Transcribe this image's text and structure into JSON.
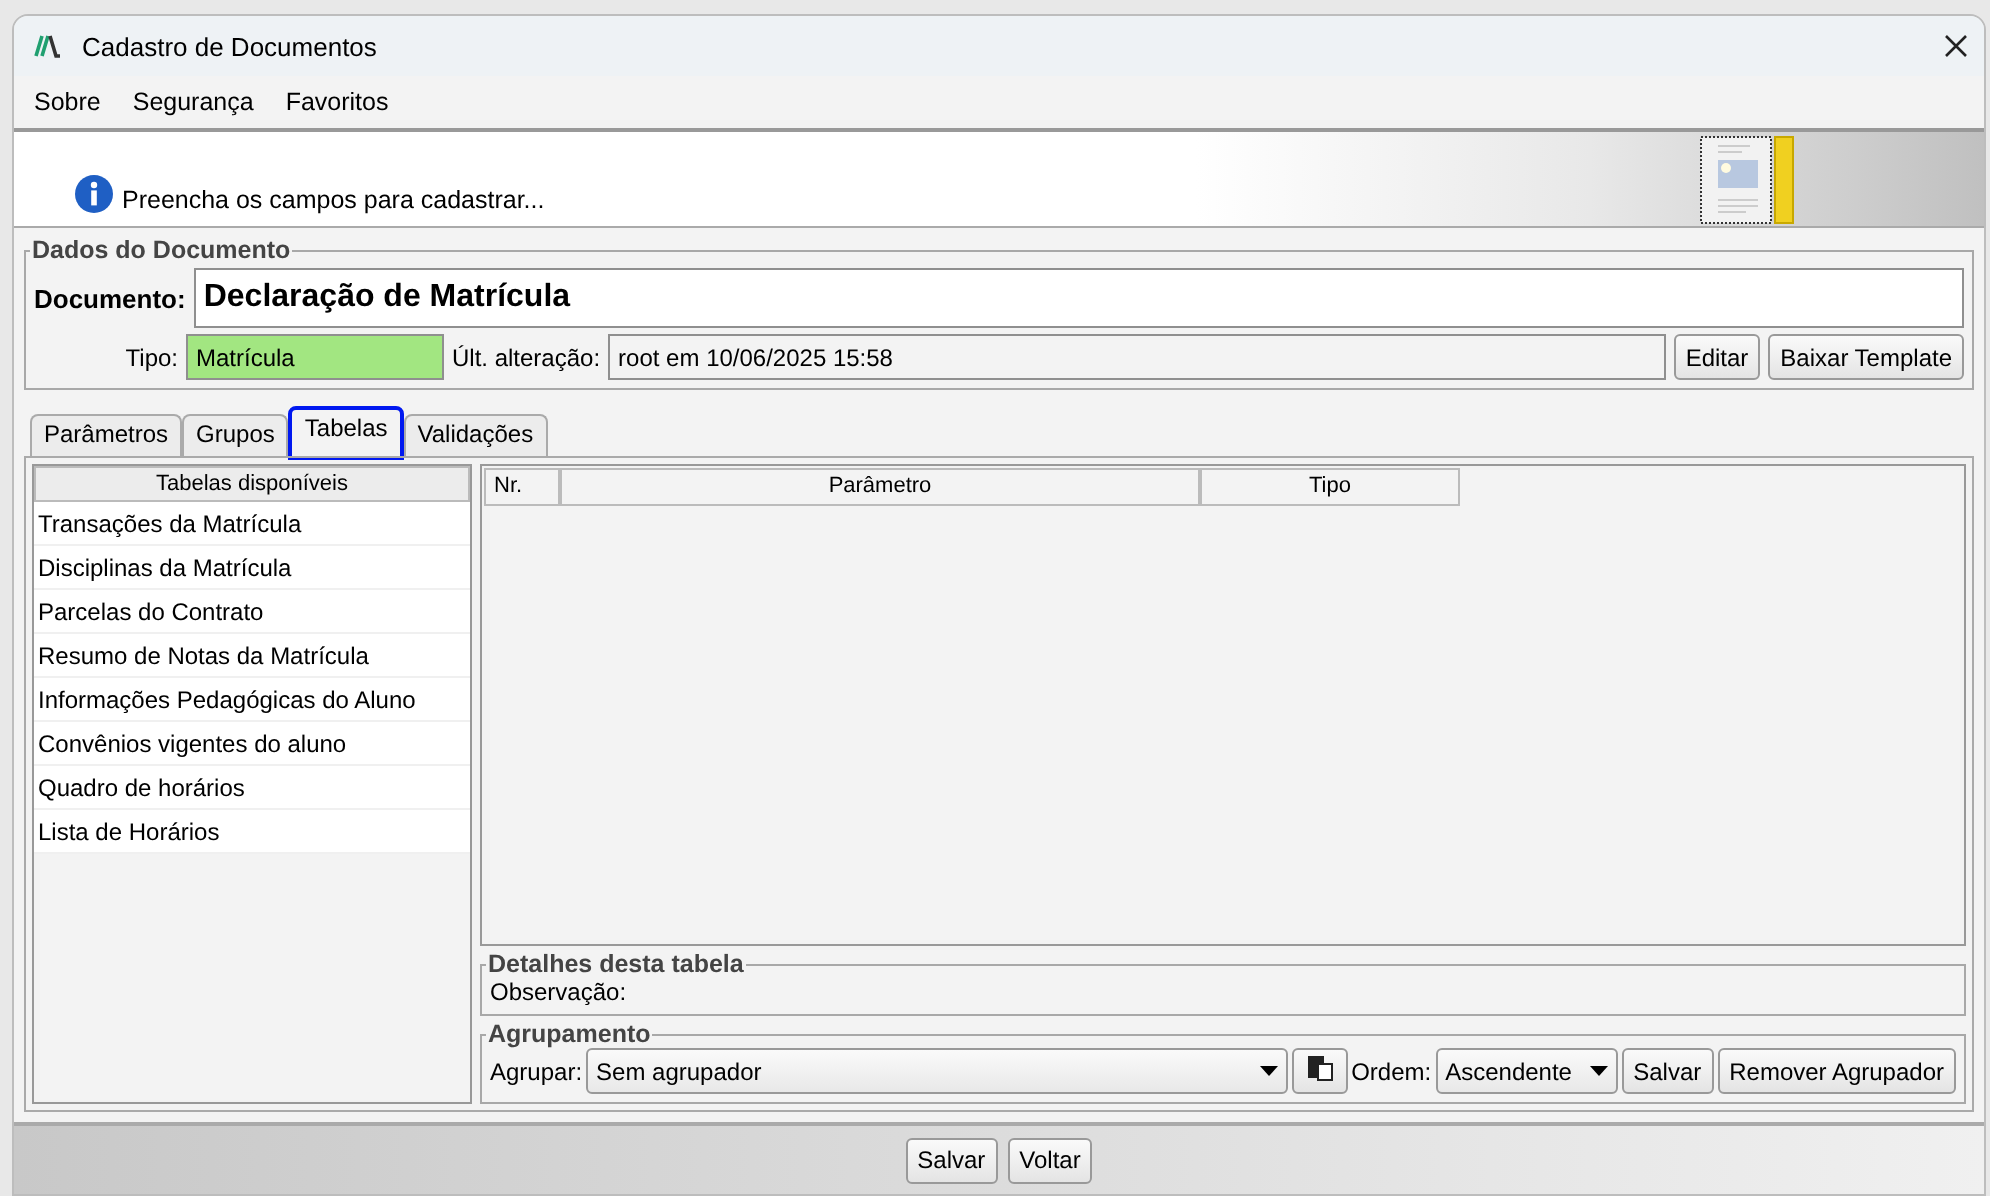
{
  "window": {
    "title": "Cadastro de Documentos"
  },
  "menu": [
    "Sobre",
    "Segurança",
    "Favoritos"
  ],
  "banner": {
    "message": "Preencha os campos para cadastrar..."
  },
  "document_group": {
    "title": "Dados do Documento",
    "document_label": "Documento:",
    "document_value": "Declaração de Matrícula",
    "type_label": "Tipo:",
    "type_value": "Matrícula",
    "changed_label": "Últ. alteração:",
    "changed_value": "root em 10/06/2025 15:58",
    "buttons": [
      "Editar",
      "Baixar Template"
    ]
  },
  "tabs": [
    {
      "label": "Parâmetros",
      "selected": false
    },
    {
      "label": "Grupos",
      "selected": false
    },
    {
      "label": "Tabelas",
      "selected": true
    },
    {
      "label": "Validações",
      "selected": false
    }
  ],
  "tables_list": {
    "header": "Tabelas disponíveis",
    "items": [
      {
        "label": "Transações da Matrícula",
        "selected": false
      },
      {
        "label": "Disciplinas da Matrícula",
        "selected": false
      },
      {
        "label": "Parcelas do Contrato",
        "selected": false
      },
      {
        "label": "Resumo de Notas da Matrícula",
        "selected": false
      },
      {
        "label": "Informações Pedagógicas do Aluno",
        "selected": false
      },
      {
        "label": "Convênios vigentes do aluno",
        "selected": false
      },
      {
        "label": "Quadro de horários",
        "selected": false
      },
      {
        "label": "Lista de Horários",
        "selected": false
      }
    ]
  },
  "parameters_table": {
    "columns": [
      "Nr.",
      "Parâmetro",
      "Tipo"
    ]
  },
  "details": {
    "title": "Detalhes desta tabela",
    "observation_label": "Observação:"
  },
  "grouping": {
    "title": "Agrupamento",
    "group_label": "Agrupar:",
    "group_value": "Sem agrupador",
    "order_label": "Ordem:",
    "order_value": "Ascendente",
    "buttons": [
      "Salvar",
      "Remover Agrupador"
    ]
  },
  "footer_buttons": [
    "Salvar",
    "Voltar"
  ]
}
